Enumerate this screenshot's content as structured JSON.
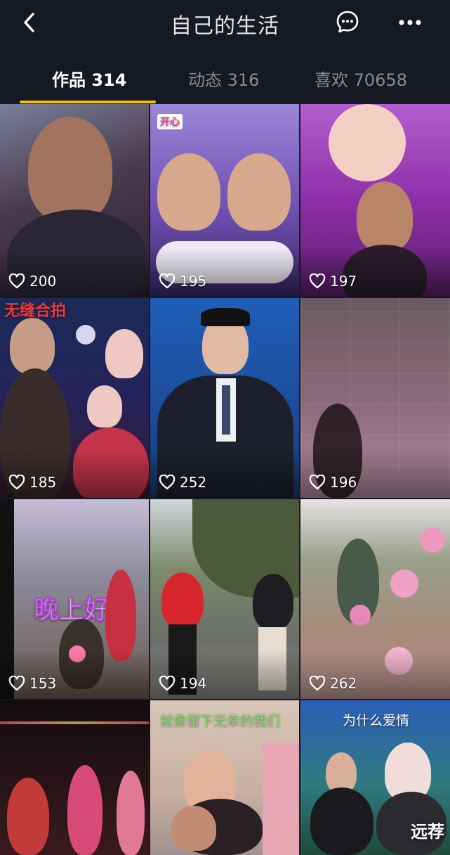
{
  "header": {
    "title": "自己的生活",
    "back_icon": "chevron-left-icon",
    "message_icon": "chat-bubble-icon",
    "more_icon": "more-dots-icon"
  },
  "tabs": [
    {
      "label": "作品 314",
      "active": true
    },
    {
      "label": "动态 316",
      "active": false
    },
    {
      "label": "喜欢 70658",
      "active": false
    }
  ],
  "accent_color": "#f2c200",
  "videos": [
    {
      "likes": "200",
      "caption": ""
    },
    {
      "likes": "195",
      "caption": "开心"
    },
    {
      "likes": "197",
      "caption": ""
    },
    {
      "likes": "185",
      "caption": "无缝合拍"
    },
    {
      "likes": "252",
      "caption": ""
    },
    {
      "likes": "196",
      "caption": ""
    },
    {
      "likes": "153",
      "caption": "晚上好"
    },
    {
      "likes": "194",
      "caption": ""
    },
    {
      "likes": "262",
      "caption": ""
    },
    {
      "likes": "",
      "caption": ""
    },
    {
      "likes": "",
      "caption": "就像留下无幸的我们"
    },
    {
      "likes": "",
      "caption": "为什么爱情"
    }
  ],
  "watermark": "远荐"
}
